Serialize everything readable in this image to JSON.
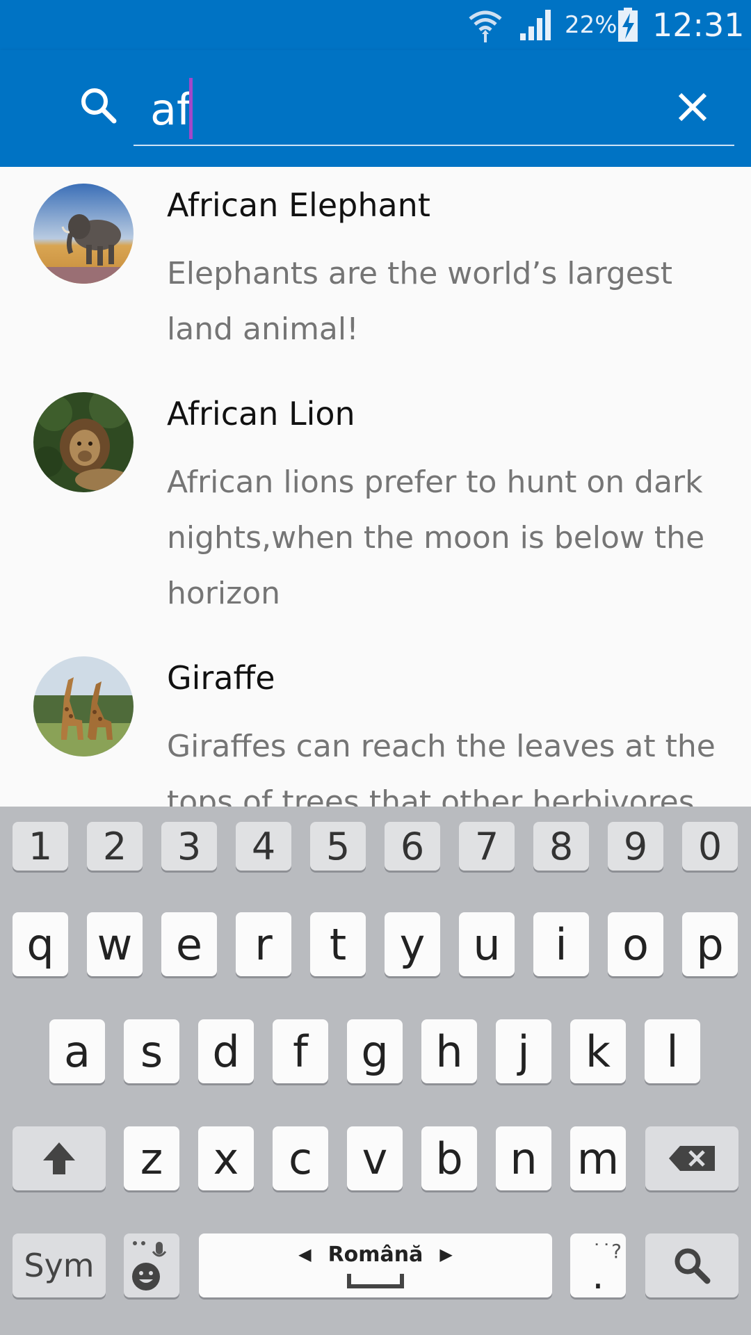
{
  "status_bar": {
    "battery_percent": "22%",
    "time": "12:31",
    "icons": [
      "wifi-icon",
      "signal-icon",
      "battery-charging-icon"
    ]
  },
  "search": {
    "value": "af",
    "icons": [
      "search-icon",
      "close-icon"
    ]
  },
  "results": [
    {
      "title": "African Elephant",
      "description": "Elephants are the world’s largest land animal!",
      "image": "elephant-photo"
    },
    {
      "title": "African Lion",
      "description": "African lions prefer to hunt on dark nights,when the moon is below the horizon",
      "image": "lion-photo"
    },
    {
      "title": "Giraffe",
      "description": "Giraffes can reach the leaves at the tops of trees that other herbivores",
      "image": "giraffe-photo"
    }
  ],
  "keyboard": {
    "numbers": [
      "1",
      "2",
      "3",
      "4",
      "5",
      "6",
      "7",
      "8",
      "9",
      "0"
    ],
    "row1": [
      "q",
      "w",
      "e",
      "r",
      "t",
      "y",
      "u",
      "i",
      "o",
      "p"
    ],
    "row2": [
      "a",
      "s",
      "d",
      "f",
      "g",
      "h",
      "j",
      "k",
      "l"
    ],
    "row3": [
      "z",
      "x",
      "c",
      "v",
      "b",
      "n",
      "m"
    ],
    "sym_label": "Sym",
    "space_language": "Română",
    "period_label": ".",
    "period_hint": "˙˙?",
    "icons": [
      "shift-icon",
      "backspace-icon",
      "emoji-icon",
      "microphone-icon",
      "search-icon"
    ]
  },
  "colors": {
    "primary": "#0073c4",
    "caret": "#a248c9",
    "keyboard_bg": "#b9bbbf"
  }
}
